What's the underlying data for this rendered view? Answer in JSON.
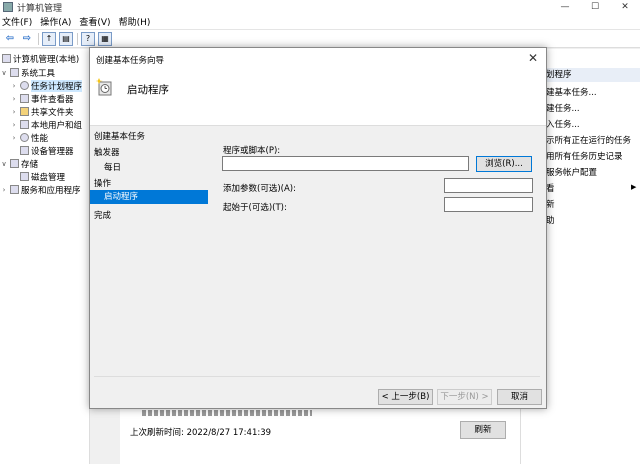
{
  "window": {
    "title": "计算机管理",
    "minimize": "—",
    "maximize": "☐",
    "close": "✕"
  },
  "menu": [
    {
      "label": "文件(F)"
    },
    {
      "label": "操作(A)"
    },
    {
      "label": "查看(V)"
    },
    {
      "label": "帮助(H)"
    }
  ],
  "tree": {
    "root": "计算机管理(本地)",
    "system_tools": "系统工具",
    "task_scheduler": "任务计划程序",
    "event_viewer": "事件查看器",
    "shared_folders": "共享文件夹",
    "local_users": "本地用户和组",
    "performance": "性能",
    "device_manager": "设备管理器",
    "storage": "存储",
    "disk_management": "磁盘管理",
    "services_apps": "服务和应用程序"
  },
  "actions": {
    "header": "划程序",
    "items": [
      "建基本任务...",
      "建任务...",
      "入任务...",
      "示所有正在运行的任务",
      "用所有任务历史记录",
      "服务帐户配置",
      "看",
      "新",
      "助"
    ]
  },
  "center": {
    "last_refresh": "上次刷新时间: 2022/8/27 17:41:39",
    "refresh_button": "刷新"
  },
  "dialog": {
    "title": "创建基本任务向导",
    "close": "✕",
    "heading": "启动程序",
    "steps": [
      {
        "label": "创建基本任务"
      },
      {
        "label": "触发器"
      },
      {
        "label": "每日"
      },
      {
        "label": "操作"
      },
      {
        "label": "启动程序"
      },
      {
        "label": "完成"
      }
    ],
    "program_label": "程序或脚本(P):",
    "program_value": "",
    "browse_button": "浏览(R)...",
    "args_label": "添加参数(可选)(A):",
    "args_value": "",
    "start_in_label": "起始于(可选)(T):",
    "start_in_value": "",
    "back_button": "< 上一步(B)",
    "next_button": "下一步(N) >",
    "cancel_button": "取消"
  }
}
